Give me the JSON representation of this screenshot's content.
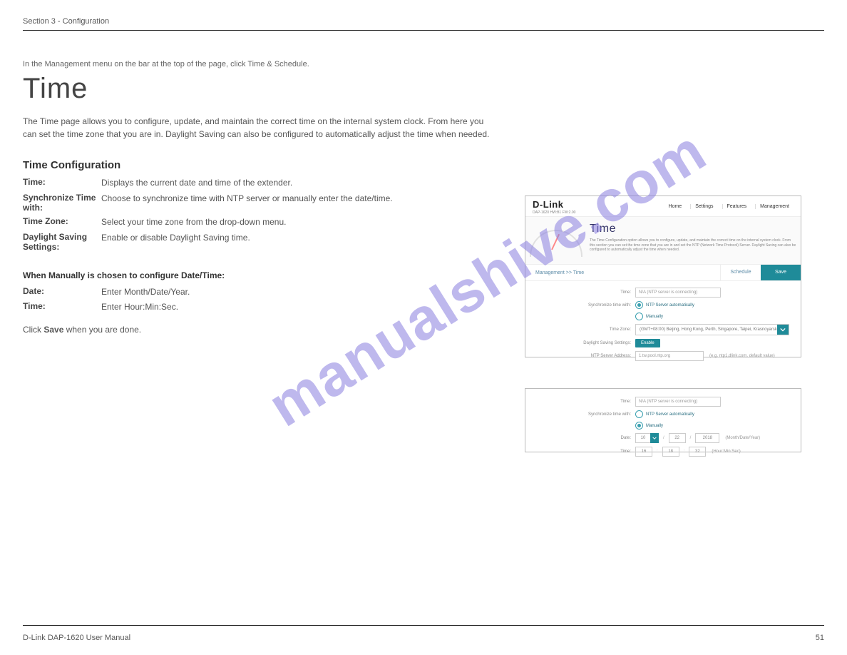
{
  "header": {
    "left": "Section 3 - Configuration"
  },
  "footer": {
    "left": "D-Link DAP-1620 User Manual",
    "right": "51"
  },
  "section_nav": "In the Management menu on the bar at the top of the page, click Time & Schedule.",
  "title": "Time",
  "intro": "The Time page allows you to configure, update, and maintain the correct time on the internal system clock. From here you can set the time zone that you are in. Daylight Saving can also be configured to automatically adjust the time when needed.",
  "watermark": "manualshive.com",
  "tc_heading": "Time Configuration",
  "fields": {
    "time": {
      "k": "Time:",
      "v": "Displays the current date and time of the extender."
    },
    "sync": {
      "k": "Synchronize Time with:",
      "v": "Choose to synchronize time with NTP server or manually enter the date/time."
    },
    "tz": {
      "k": "Time Zone:",
      "v": "Select your time zone from the drop-down menu."
    },
    "dst": {
      "k": "Daylight Saving Settings:",
      "v": "Enable or disable Daylight Saving time."
    }
  },
  "manual_heading": "When Manually is chosen to configure Date/Time:",
  "manual": {
    "date": {
      "k": "Date:",
      "v": "Enter Month/Date/Year."
    },
    "time": {
      "k": "Time:",
      "v": "Enter Hour:Min:Sec."
    }
  },
  "note_label": "Click",
  "note_bold": "Save",
  "note_rest": "when you are done.",
  "shot1": {
    "brand": "D-Link",
    "brand_sub": "DAP-1620   HW:B1   FW:2.00",
    "nav": [
      "Home",
      "Settings",
      "Features",
      "Management"
    ],
    "hero_title": "Time",
    "hero_desc": "The Time Configuration option allows you to configure, update, and maintain the correct time on the internal system clock. From this section you can set the time zone that you are in and set the NTP (Network Time Protocol) Server. Daylight Saving can also be configured to automatically adjust the time when needed.",
    "bc": "Management >> Time",
    "schedule": "Schedule",
    "save": "Save",
    "time_label": "Time:",
    "time_val": "N/A (NTP server is connecting)",
    "sync_label": "Synchronize time with:",
    "sync_opt1": "NTP Server automatically",
    "sync_opt2": "Manually",
    "tz_label": "Time Zone:",
    "tz_val": "(GMT+08:00) Beijing, Hong Kong, Perth, Singapore, Taipei, Krasnoyarsk",
    "dst_label": "Daylight Saving Settings:",
    "dst_btn": "Enable",
    "ntp_label": "NTP Server Address:",
    "ntp_val": "1.tw.pool.ntp.org",
    "ntp_hint": "(e.g. ntp1.dlink.com. default value)"
  },
  "shot2": {
    "time_label": "Time:",
    "time_val": "N/A (NTP server is connecting)",
    "sync_label": "Synchronize time with:",
    "sync_opt1": "NTP Server automatically",
    "sync_opt2": "Manually",
    "date_label": "Date:",
    "month": "10",
    "day": "22",
    "year": "2018",
    "date_hint": "(Month/Date/Year)",
    "t2_label": "Time:",
    "hh": "16",
    "mm": "18",
    "ss": "32",
    "time_hint": "(Hour:Min:Sec)"
  }
}
